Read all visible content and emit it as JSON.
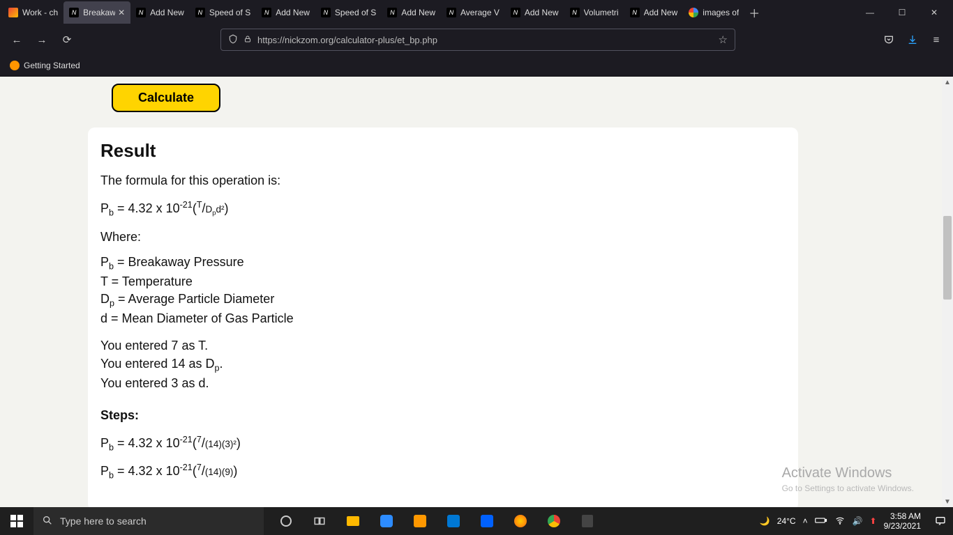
{
  "browser": {
    "tabs": [
      {
        "title": "Work - ch",
        "favicon": "gmail"
      },
      {
        "title": "Breakaw",
        "favicon": "n",
        "active": true
      },
      {
        "title": "Add New",
        "favicon": "n"
      },
      {
        "title": "Speed of S",
        "favicon": "n"
      },
      {
        "title": "Add New",
        "favicon": "n"
      },
      {
        "title": "Speed of S",
        "favicon": "n"
      },
      {
        "title": "Add New",
        "favicon": "n"
      },
      {
        "title": "Average V",
        "favicon": "n"
      },
      {
        "title": "Add New",
        "favicon": "n"
      },
      {
        "title": "Volumetri",
        "favicon": "n"
      },
      {
        "title": "Add New",
        "favicon": "n"
      },
      {
        "title": "images of",
        "favicon": "g"
      }
    ],
    "url": "https://nickzom.org/calculator-plus/et_bp.php",
    "bookmarks": [
      {
        "label": "Getting Started"
      }
    ]
  },
  "page": {
    "calculate_label": "Calculate",
    "result_heading": "Result",
    "formula_intro": "The formula for this operation is:",
    "formula_constant": "4.32 x 10",
    "formula_exp": "-21",
    "where_label": "Where:",
    "definitions": {
      "Pb": "Breakaway Pressure",
      "T": "Temperature",
      "Dp": "Average Particle Diameter",
      "d": "Mean Diameter of Gas Particle"
    },
    "inputs": {
      "T": "7",
      "Dp": "14",
      "d": "3"
    },
    "entered_lines": {
      "T": "You entered 7 as T.",
      "d": "You entered 3 as d."
    },
    "steps_label": "Steps:",
    "step1_denom": "(14)(3)²",
    "step2_denom": "(14)(9)"
  },
  "watermark": {
    "line1": "Activate Windows",
    "line2": "Go to Settings to activate Windows."
  },
  "taskbar": {
    "search_placeholder": "Type here to search",
    "weather": "24°C",
    "time": "3:58 AM",
    "date": "9/23/2021"
  }
}
